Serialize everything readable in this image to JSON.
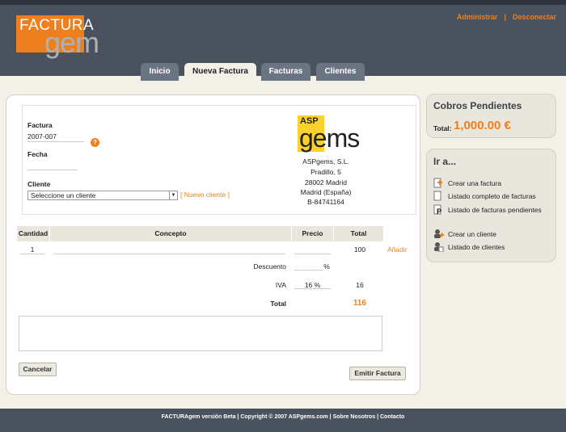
{
  "header": {
    "logo_top": "FACTURA",
    "logo_bottom": "gem",
    "links": [
      "Administrar",
      "Desconectar"
    ],
    "separator": "|",
    "tabs": [
      {
        "label": "Inicio",
        "active": false
      },
      {
        "label": "Nueva Factura",
        "active": true
      },
      {
        "label": "Facturas",
        "active": false
      },
      {
        "label": "Clientes",
        "active": false
      }
    ]
  },
  "invoice": {
    "factura_label": "Factura",
    "factura_value": "2007-007",
    "help_icon": "question-icon",
    "fecha_label": "Fecha",
    "fecha_value": "",
    "cliente_label": "Cliente",
    "cliente_select": "Seleccione un cliente",
    "new_client": "[ Nuevo cliente ]",
    "company": {
      "logo_top": "ASP",
      "logo_bottom": "gems",
      "lines": [
        "ASPgems, S.L.",
        "Pradillo, 5",
        "28002 Madrid",
        "Madrid (España)",
        "B-84741164"
      ]
    }
  },
  "items": {
    "headers": [
      "Cantidad",
      "Concepto",
      "Precio",
      "Total"
    ],
    "row": {
      "cantidad": "1",
      "concepto": "",
      "precio": "",
      "total": "100"
    },
    "add_label": "Añadir",
    "descuento_label": "Descuento",
    "descuento_unit": "%",
    "iva_label": "IVA",
    "iva_value": "16 %",
    "iva_total": "16",
    "total_label": "Total",
    "total_value": "116"
  },
  "buttons": {
    "cancel": "Cancelar",
    "emit": "Emitir Factura"
  },
  "sidebar": {
    "cobros_title": "Cobros Pendientes",
    "total_label": "Total:",
    "total_value": "1,000.00 €",
    "ira_title": "Ir a...",
    "links": [
      {
        "label": "Crear una factura",
        "icon": "new-document-icon"
      },
      {
        "label": "Listado completo de facturas",
        "icon": "document-icon"
      },
      {
        "label": "Listado de facturas pendientes",
        "icon": "pending-document-icon"
      },
      {
        "label": "Crear un cliente",
        "icon": "add-user-icon"
      },
      {
        "label": "Listado de clientes",
        "icon": "users-list-icon"
      }
    ]
  },
  "footer": {
    "brand": "FACTURAgem versión Beta",
    "copyright": "Copyright © 2007 ASPgems.com",
    "about": "Sobre Nosotros",
    "contact": "Contacto",
    "separator": "|"
  },
  "colors": {
    "accent": "#ee7f1e",
    "header": "#4a525f",
    "background": "#f3f0e8"
  }
}
